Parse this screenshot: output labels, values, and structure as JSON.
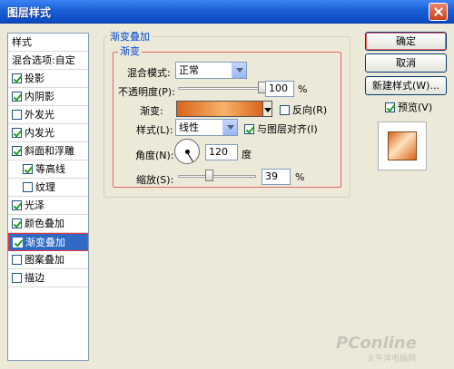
{
  "window": {
    "title": "图层样式"
  },
  "sidebar": {
    "header": "样式",
    "blend_options": "混合选项:自定",
    "items": [
      {
        "label": "投影",
        "checked": true
      },
      {
        "label": "内阴影",
        "checked": true
      },
      {
        "label": "外发光",
        "checked": false
      },
      {
        "label": "内发光",
        "checked": true
      },
      {
        "label": "斜面和浮雕",
        "checked": true
      },
      {
        "label": "等高线",
        "checked": true
      },
      {
        "label": "纹理",
        "checked": false
      },
      {
        "label": "光泽",
        "checked": true
      },
      {
        "label": "颜色叠加",
        "checked": true
      },
      {
        "label": "渐变叠加",
        "checked": true,
        "selected": true
      },
      {
        "label": "图案叠加",
        "checked": false
      },
      {
        "label": "描边",
        "checked": false
      }
    ]
  },
  "panel": {
    "group_title": "渐变叠加",
    "inner_title": "渐变",
    "blend_mode_label": "混合模式:",
    "blend_mode_value": "正常",
    "opacity_label": "不透明度(P):",
    "opacity_value": "100",
    "opacity_unit": "%",
    "opacity_fraction": 1.0,
    "gradient_label": "渐变:",
    "reverse_label": "反向(R)",
    "reverse_checked": false,
    "style_label": "样式(L):",
    "style_value": "线性",
    "align_label": "与图层对齐(I)",
    "align_checked": true,
    "angle_label": "角度(N):",
    "angle_value": "120",
    "angle_unit": "度",
    "scale_label": "缩放(S):",
    "scale_value": "39",
    "scale_unit": "%",
    "scale_fraction": 0.39
  },
  "buttons": {
    "ok": "确定",
    "cancel": "取消",
    "new_style": "新建样式(W)...",
    "preview_label": "预览(V)",
    "preview_checked": true
  },
  "watermark": {
    "main": "PConline",
    "sub": "太平洋电脑网"
  },
  "colors": {
    "gradient_start": "#d9641a",
    "gradient_mid": "#f7b36a",
    "gradient_end": "#ffe2bf",
    "selection": "#316ac5",
    "title_bar": "#0c49c2"
  }
}
